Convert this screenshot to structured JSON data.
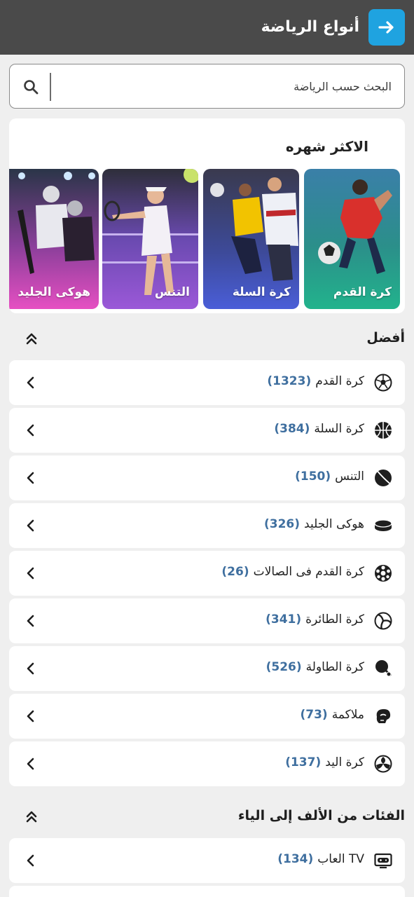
{
  "header": {
    "title": "أنواع الرياضة"
  },
  "search": {
    "placeholder": "البحث حسب الرياضة"
  },
  "popular": {
    "title": "الاكثر شهره",
    "cards": [
      {
        "label": "كرة القدم"
      },
      {
        "label": "كرة السلة"
      },
      {
        "label": "التنس"
      },
      {
        "label": "هوكى الجليد"
      }
    ]
  },
  "best": {
    "title": "أفضل",
    "items": [
      {
        "name": "كرة القدم",
        "count": "(1323)",
        "icon": "soccer-ball-icon"
      },
      {
        "name": "كرة السلة",
        "count": "(384)",
        "icon": "basketball-icon"
      },
      {
        "name": "التنس",
        "count": "(150)",
        "icon": "tennis-ball-icon"
      },
      {
        "name": "هوكى الجليد",
        "count": "(326)",
        "icon": "hockey-puck-icon"
      },
      {
        "name": "كرة القدم فى الصالات",
        "count": "(26)",
        "icon": "futsal-ball-icon"
      },
      {
        "name": "كرة الطائرة",
        "count": "(341)",
        "icon": "volleyball-icon"
      },
      {
        "name": "كرة الطاولة",
        "count": "(526)",
        "icon": "ping-pong-icon"
      },
      {
        "name": "ملاكمة",
        "count": "(73)",
        "icon": "boxing-glove-icon"
      },
      {
        "name": "كرة اليد",
        "count": "(137)",
        "icon": "handball-icon"
      }
    ]
  },
  "az": {
    "title": "الفئات من الألف إلى الياء",
    "items": [
      {
        "name": "TV العاب",
        "count": "(134)",
        "icon": "tv-gamepad-icon"
      }
    ]
  },
  "colors": {
    "header": "#4a4a4a",
    "accent": "#1fa3e0",
    "count": "#3f6f9f"
  }
}
